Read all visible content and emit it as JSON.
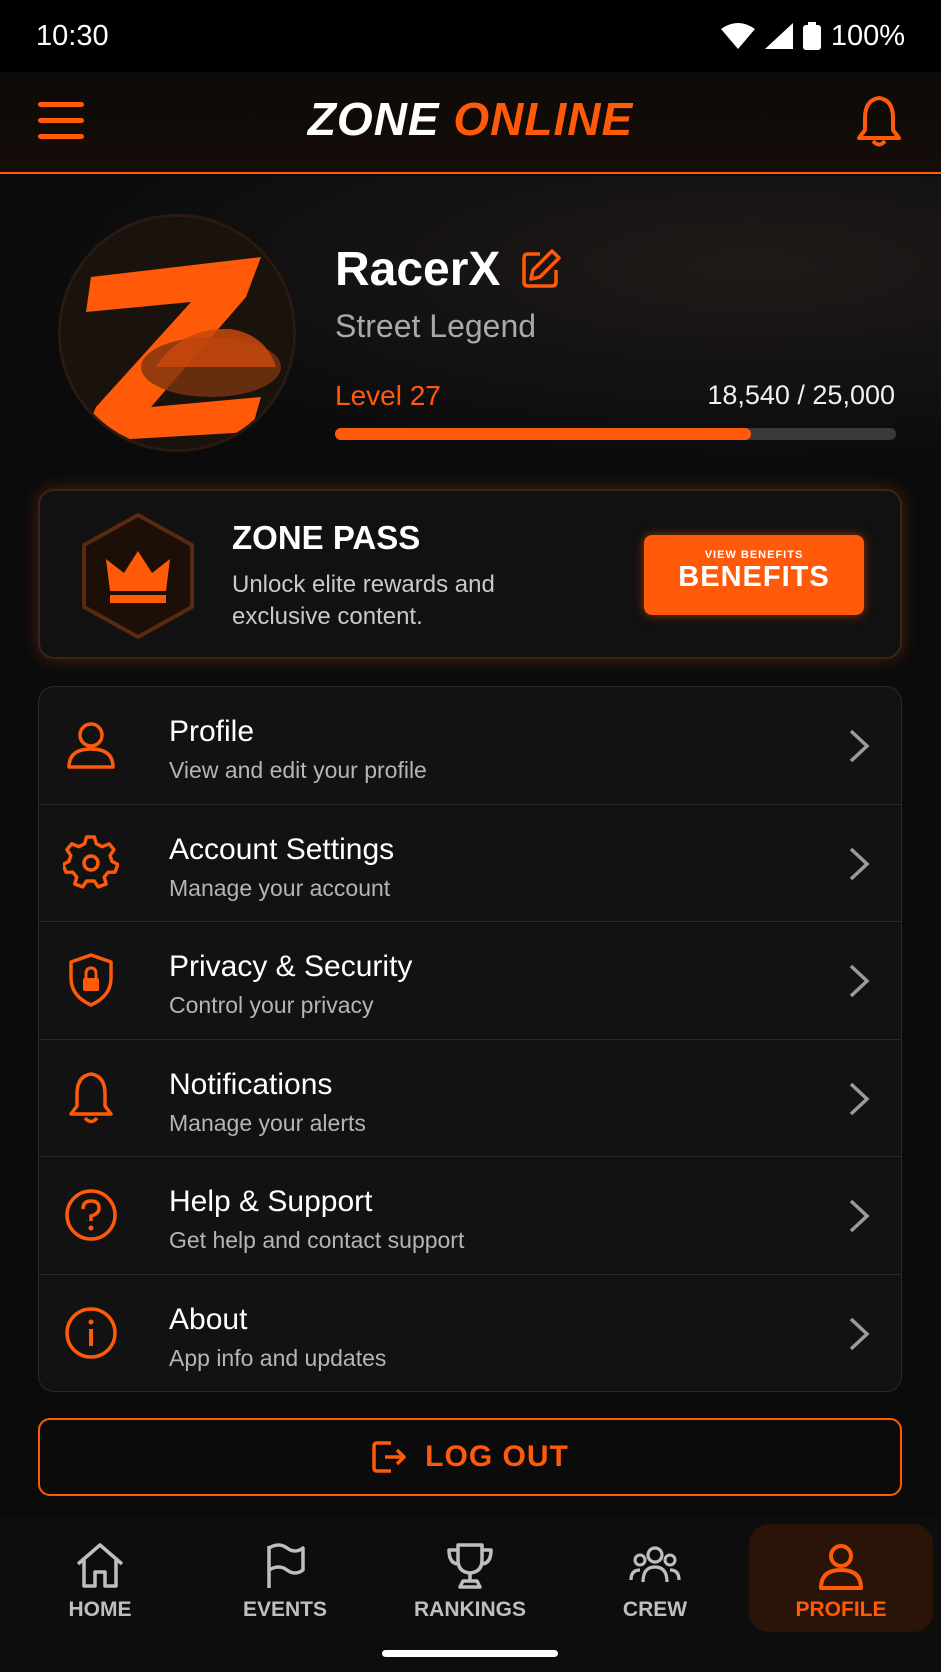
{
  "status_bar": {
    "time": "10:30",
    "battery": "100%"
  },
  "header": {
    "logo_part1": "ZONE",
    "logo_part2": "ONLINE"
  },
  "profile": {
    "username": "RacerX",
    "title": "Street Legend",
    "level": "Level 27",
    "xp_text": "18,540 / 25,000",
    "xp_progress": 0.7416
  },
  "zone_pass": {
    "title": "ZONE PASS",
    "description": "Unlock elite rewards and exclusive content.",
    "button_small": "VIEW BENEFITS",
    "button_label": "BENEFITS"
  },
  "menu": [
    {
      "label": "Profile",
      "sub": "View and edit your profile",
      "icon": "user-icon"
    },
    {
      "label": "Account Settings",
      "sub": "Manage your account",
      "icon": "gear-icon"
    },
    {
      "label": "Privacy & Security",
      "sub": "Control your privacy",
      "icon": "shield-lock-icon"
    },
    {
      "label": "Notifications",
      "sub": "Manage your alerts",
      "icon": "bell-icon"
    },
    {
      "label": "Help & Support",
      "sub": "Get help and contact support",
      "icon": "help-icon"
    },
    {
      "label": "About",
      "sub": "App info and updates",
      "icon": "info-icon"
    }
  ],
  "logout": {
    "label": "LOG OUT"
  },
  "nav": [
    {
      "label": "HOME",
      "icon": "home-icon"
    },
    {
      "label": "EVENTS",
      "icon": "flag-icon"
    },
    {
      "label": "RANKINGS",
      "icon": "trophy-icon"
    },
    {
      "label": "CREW",
      "icon": "crew-icon"
    },
    {
      "label": "PROFILE",
      "icon": "user-icon",
      "active": true
    }
  ],
  "colors": {
    "accent": "#ff5a0a",
    "background": "#0b0b0c",
    "card": "#121213"
  }
}
